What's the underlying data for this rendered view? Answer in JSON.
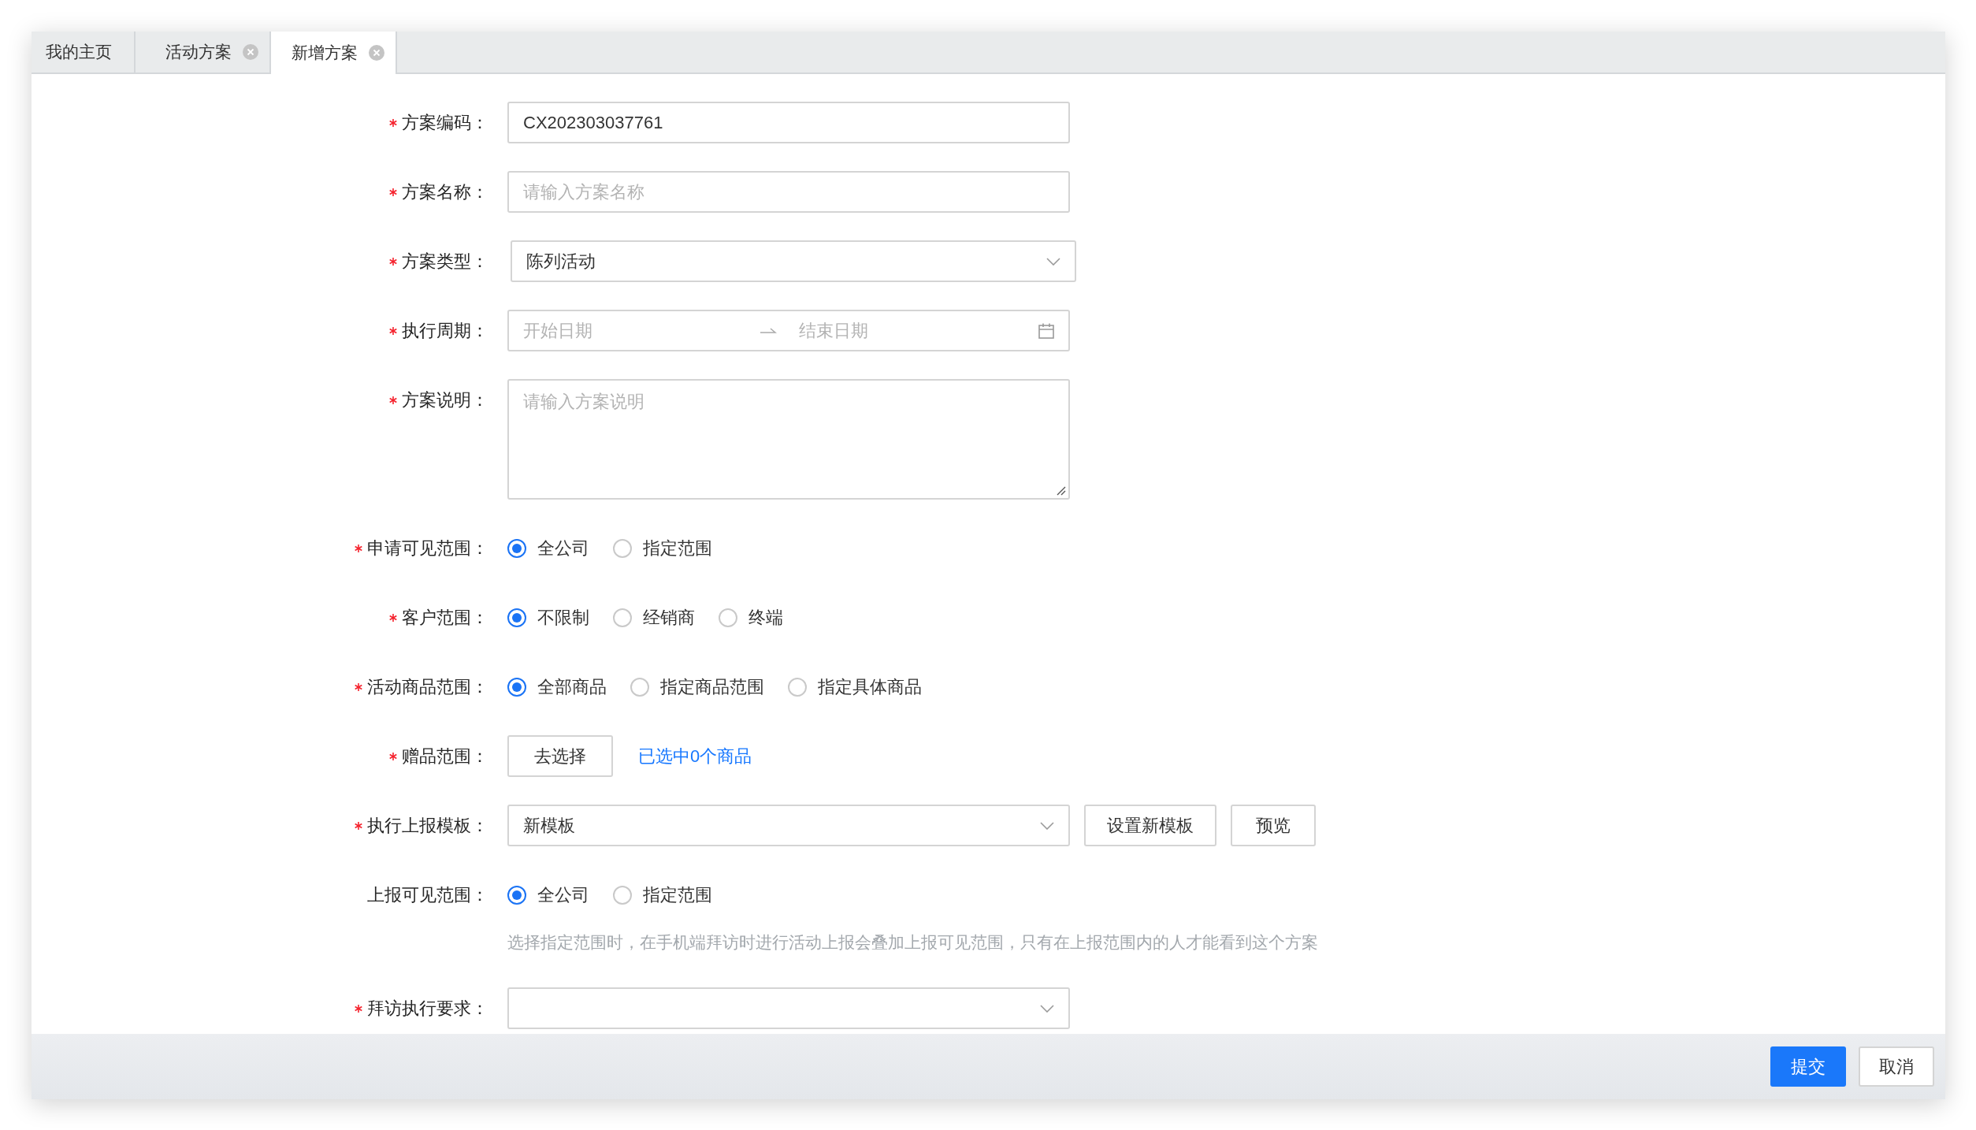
{
  "tabs": [
    {
      "label": "我的主页",
      "selected": false,
      "closable": false
    },
    {
      "label": "活动方案",
      "selected": false,
      "closable": true
    },
    {
      "label": "新增方案",
      "selected": true,
      "closable": true
    }
  ],
  "form": {
    "fields": [
      {
        "kind": "text",
        "label": "方案编码：",
        "required": true,
        "value": "CX202303037761"
      },
      {
        "kind": "text",
        "label": "方案名称：",
        "required": true,
        "placeholder": "请输入方案名称"
      },
      {
        "kind": "select",
        "label": "方案类型：",
        "required": true,
        "value": "陈列活动"
      },
      {
        "kind": "daterange",
        "label": "执行周期：",
        "required": true,
        "start_placeholder": "开始日期",
        "end_placeholder": "结束日期"
      },
      {
        "kind": "textarea",
        "label": "方案说明：",
        "required": true,
        "placeholder": "请输入方案说明"
      },
      {
        "kind": "radio",
        "label": "申请可见范围：",
        "required": true,
        "options": [
          {
            "label": "全公司",
            "selected": true
          },
          {
            "label": "指定范围",
            "selected": false
          }
        ]
      },
      {
        "kind": "radio",
        "label": "客户范围：",
        "required": true,
        "options": [
          {
            "label": "不限制",
            "selected": true
          },
          {
            "label": "经销商",
            "selected": false
          },
          {
            "label": "终端",
            "selected": false
          }
        ]
      },
      {
        "kind": "radio",
        "label": "活动商品范围：",
        "required": true,
        "options": [
          {
            "label": "全部商品",
            "selected": true
          },
          {
            "label": "指定商品范围",
            "selected": false
          },
          {
            "label": "指定具体商品",
            "selected": false
          }
        ]
      },
      {
        "kind": "picker",
        "label": "赠品范围：",
        "required": true,
        "button": "去选择",
        "link": "已选中0个商品"
      },
      {
        "kind": "select",
        "label": "执行上报模板：",
        "required": true,
        "value": "新模板",
        "buttons": [
          "设置新模板",
          "预览"
        ]
      },
      {
        "kind": "radio",
        "label": "上报可见范围：",
        "required": false,
        "options": [
          {
            "label": "全公司",
            "selected": true
          },
          {
            "label": "指定范围",
            "selected": false
          }
        ],
        "hint": "选择指定范围时，在手机端拜访时进行活动上报会叠加上报可见范围，只有在上报范围内的人才能看到这个方案"
      },
      {
        "kind": "select",
        "label": "拜访执行要求：",
        "required": true
      }
    ]
  },
  "footer": {
    "buttons": [
      {
        "label": "提交",
        "primary": true
      },
      {
        "label": "取消",
        "primary": false
      }
    ]
  }
}
